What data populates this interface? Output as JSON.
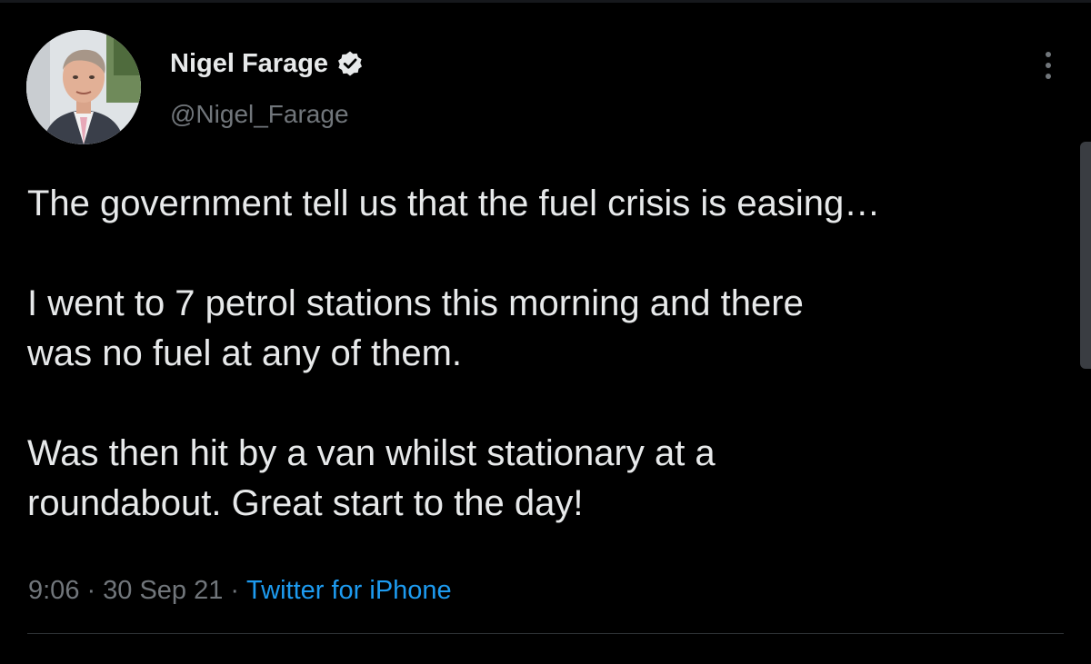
{
  "author": {
    "name": "Nigel Farage",
    "handle": "@Nigel_Farage",
    "verified": true,
    "avatar_icon": "profile-photo"
  },
  "tweet": {
    "paragraphs": [
      [
        "The government tell us that the fuel crisis is easing…"
      ],
      [
        "I went to 7 petrol stations this morning and there",
        "was no fuel at any of them."
      ],
      [
        "Was then hit by a van whilst stationary at a",
        "roundabout. Great start to the day!"
      ]
    ]
  },
  "meta": {
    "time": "9:06",
    "date": "30 Sep 21",
    "separator": "·",
    "source": "Twitter for iPhone"
  },
  "icons": {
    "more": "more-vertical-icon",
    "verified": "verified-badge-icon"
  },
  "colors": {
    "background": "#000000",
    "text": "#e7e9ea",
    "secondary": "#71767b",
    "link": "#1d9bf0",
    "divider": "#2f3336"
  }
}
